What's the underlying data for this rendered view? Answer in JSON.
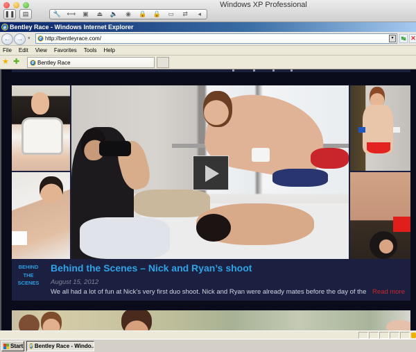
{
  "host": {
    "window_title": "Windows XP Professional",
    "toolbar_icons": [
      "pause-icon",
      "snapshot-icon",
      "settings-wrench-icon",
      "resize-icon",
      "refresh-icon",
      "usb-icon",
      "sound-icon",
      "cd-icon",
      "lock-icon",
      "lock-alt-icon",
      "floppy-icon",
      "network-icon",
      "more-icon"
    ],
    "toolbar_glyphs": [
      "🔧",
      "⟷",
      "▣",
      "⏏",
      "🔈",
      "◉",
      "🔒",
      "🔒",
      "▭",
      "⇄",
      "◂"
    ],
    "pause_glyph": "❚❚",
    "snapshot_glyph": "▤"
  },
  "browser": {
    "title": "Bentley Race - Windows Internet Explorer",
    "ie_glyph": "e",
    "back_glyph": "←",
    "forward_glyph": "→",
    "dropdown_glyph": "▾",
    "address": "http://bentleyrace.com/",
    "go_glyph": "↹",
    "stop_glyph": "✕",
    "menu": [
      "File",
      "Edit",
      "View",
      "Favorites",
      "Tools",
      "Help"
    ],
    "favorites_glyph": "★",
    "add_favorites_glyph": "✚",
    "tab_label": "Bentley Race"
  },
  "post": {
    "category_lines": [
      "BEHIND",
      "THE",
      "SCENES"
    ],
    "title": "Behind the Scenes – Nick and Ryan’s shoot",
    "date": "August 15, 2012",
    "excerpt": "We all had a lot of fun at Nick’s very first duo shoot. Nick and Ryan were already mates before the day of the",
    "read_more": "Read more",
    "colors": {
      "category": "#2c9be0",
      "title": "#2ea3e6",
      "read_more": "#c8262c",
      "card_bg": "#1c2040",
      "page_bg": "#0a0c1c"
    }
  },
  "taskbar": {
    "start_label": "Start",
    "task_label": "Bentley Race - Windo..."
  }
}
